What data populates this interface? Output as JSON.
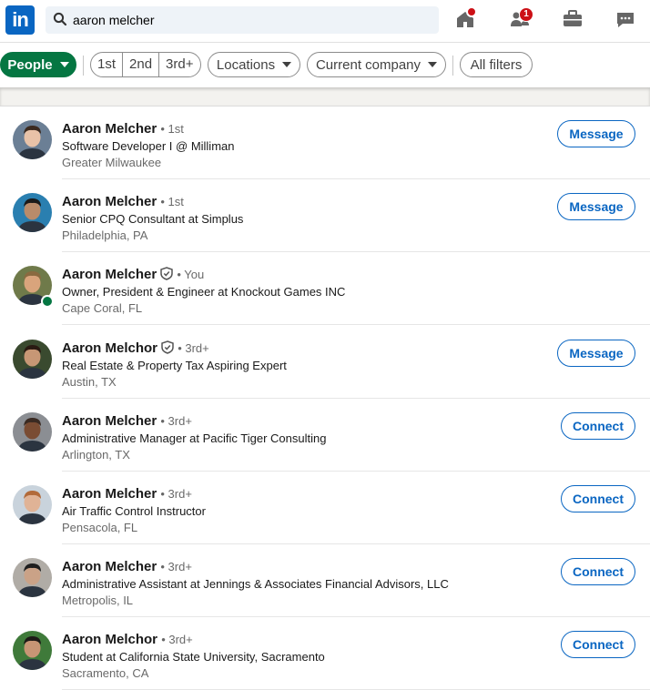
{
  "topbar": {
    "logo_text": "in",
    "search_value": "aaron melcher",
    "notification_badge": "1"
  },
  "filters": {
    "people_label": "People",
    "degrees": [
      "1st",
      "2nd",
      "3rd+"
    ],
    "locations_label": "Locations",
    "company_label": "Current company",
    "all_filters_label": "All filters"
  },
  "results": [
    {
      "name": "Aaron Melcher",
      "verified": false,
      "degree": "• 1st",
      "headline": "Software Developer I @ Milliman",
      "location": "Greater Milwaukee",
      "action": "Message",
      "online": false,
      "avatar_colors": [
        "#6b7f95",
        "#e8c2a8",
        "#3b2a1f"
      ]
    },
    {
      "name": "Aaron Melcher",
      "verified": false,
      "degree": "• 1st",
      "headline": "Senior CPQ Consultant at Simplus",
      "location": "Philadelphia, PA",
      "action": "Message",
      "online": false,
      "avatar_colors": [
        "#2a7fb0",
        "#b98b6a",
        "#1a1a1a"
      ]
    },
    {
      "name": "Aaron Melcher",
      "verified": true,
      "degree": "• You",
      "headline": "Owner, President & Engineer at Knockout Games INC",
      "location": "Cape Coral, FL",
      "action": "",
      "online": true,
      "avatar_colors": [
        "#6f7a4a",
        "#d9a47c",
        "#8a6a40"
      ]
    },
    {
      "name": "Aaron Melchor",
      "verified": true,
      "degree": "• 3rd+",
      "headline": "Real Estate & Property Tax Aspiring Expert",
      "location": "Austin, TX",
      "action": "Message",
      "online": false,
      "avatar_colors": [
        "#3a4a2f",
        "#c79775",
        "#2a1a12"
      ]
    },
    {
      "name": "Aaron Melcher",
      "verified": false,
      "degree": "• 3rd+",
      "headline": "Administrative Manager at Pacific Tiger Consulting",
      "location": "Arlington, TX",
      "action": "Connect",
      "online": false,
      "avatar_colors": [
        "#8b8e93",
        "#7a4c33",
        "#3a2a22"
      ]
    },
    {
      "name": "Aaron Melcher",
      "verified": false,
      "degree": "• 3rd+",
      "headline": "Air Traffic Control Instructor",
      "location": "Pensacola, FL",
      "action": "Connect",
      "online": false,
      "avatar_colors": [
        "#c9d3dc",
        "#e0b396",
        "#b26a3a"
      ]
    },
    {
      "name": "Aaron Melcher",
      "verified": false,
      "degree": "• 3rd+",
      "headline": "Administrative Assistant at Jennings & Associates Financial Advisors, LLC",
      "location": "Metropolis, IL",
      "action": "Connect",
      "online": false,
      "avatar_colors": [
        "#b0aca6",
        "#caa287",
        "#1e1e1e"
      ]
    },
    {
      "name": "Aaron Melchor",
      "verified": false,
      "degree": "• 3rd+",
      "headline": "Student at California State University, Sacramento",
      "location": "Sacramento, CA",
      "action": "Connect",
      "online": false,
      "avatar_colors": [
        "#3f7a3a",
        "#c79575",
        "#1d1a17"
      ]
    }
  ],
  "colors": {
    "brand": "#0a66c2",
    "people_active": "#057642",
    "badge": "#cc1016"
  }
}
